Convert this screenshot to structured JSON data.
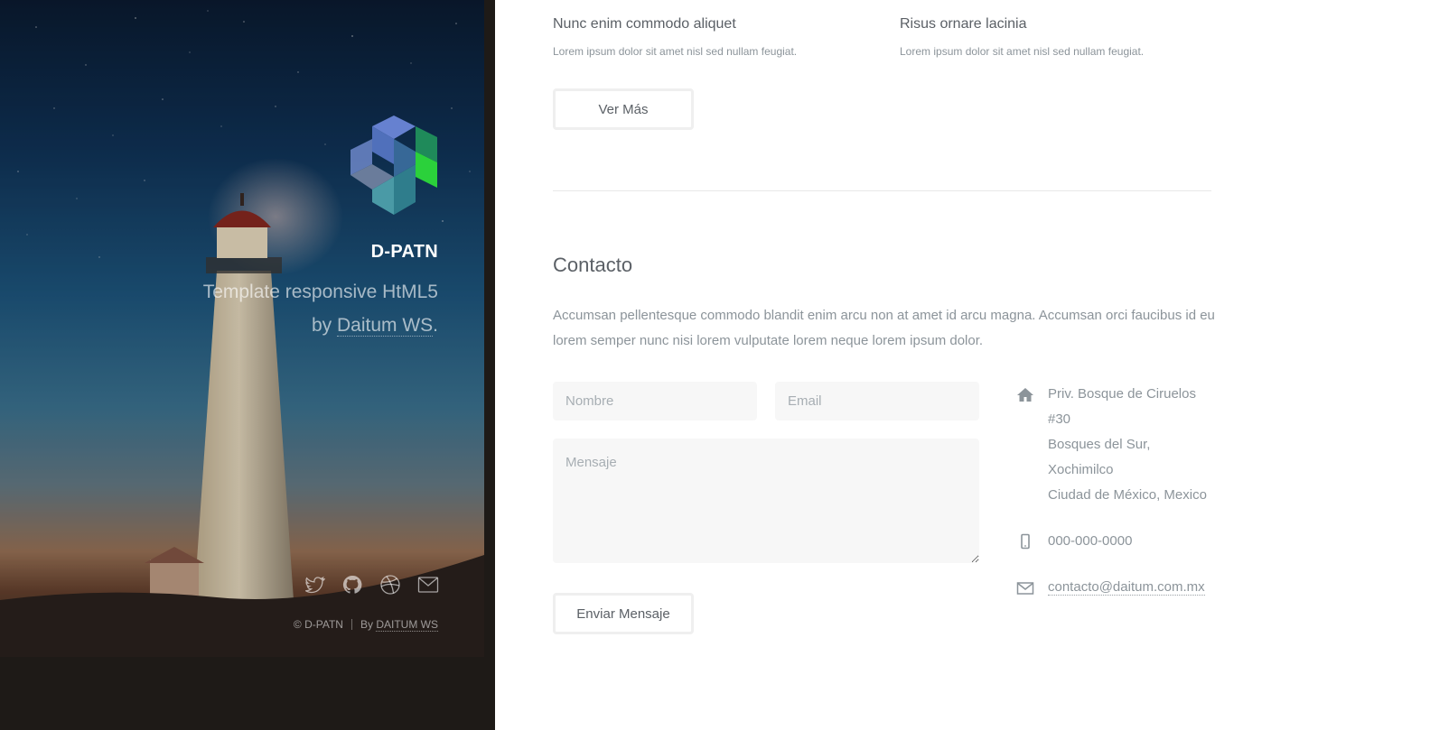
{
  "header": {
    "title": "D-PATN",
    "tagline_line1": "Template responsive HtML5",
    "tagline_by": "by",
    "tagline_link": "Daitum WS",
    "tagline_end": ".",
    "social": [
      "twitter-icon",
      "github-icon",
      "dribbble-icon",
      "envelope-icon"
    ],
    "copyright": "© D-PATN",
    "credit_by": "By",
    "credit_link": "DAITUM WS"
  },
  "features": [
    {
      "title": "Nunc enim commodo aliquet",
      "text": "Lorem ipsum dolor sit amet nisl sed nullam feugiat."
    },
    {
      "title": "Risus ornare lacinia",
      "text": "Lorem ipsum dolor sit amet nisl sed nullam feugiat."
    }
  ],
  "more_button": "Ver Más",
  "contact": {
    "title": "Contacto",
    "text": "Accumsan pellentesque commodo blandit enim arcu non at amet id arcu magna. Accumsan orci faucibus id eu lorem semper nunc nisi lorem vulputate lorem neque lorem ipsum dolor.",
    "form": {
      "name_placeholder": "Nombre",
      "email_placeholder": "Email",
      "message_placeholder": "Mensaje",
      "submit": "Enviar Mensaje"
    },
    "address": [
      "Priv. Bosque de Ciruelos",
      "#30",
      "Bosques del Sur,",
      "Xochimilco",
      "Ciudad de México, Mexico"
    ],
    "phone": "000-000-0000",
    "email": "contacto@daitum.com.mx",
    "icons": [
      "home-icon",
      "mobile-icon",
      "envelope-icon"
    ]
  },
  "colors": {
    "text": "#7f888f",
    "heading": "#5b6066",
    "field_bg": "#f7f7f7",
    "sidebar_bg": "#1e1a17"
  }
}
